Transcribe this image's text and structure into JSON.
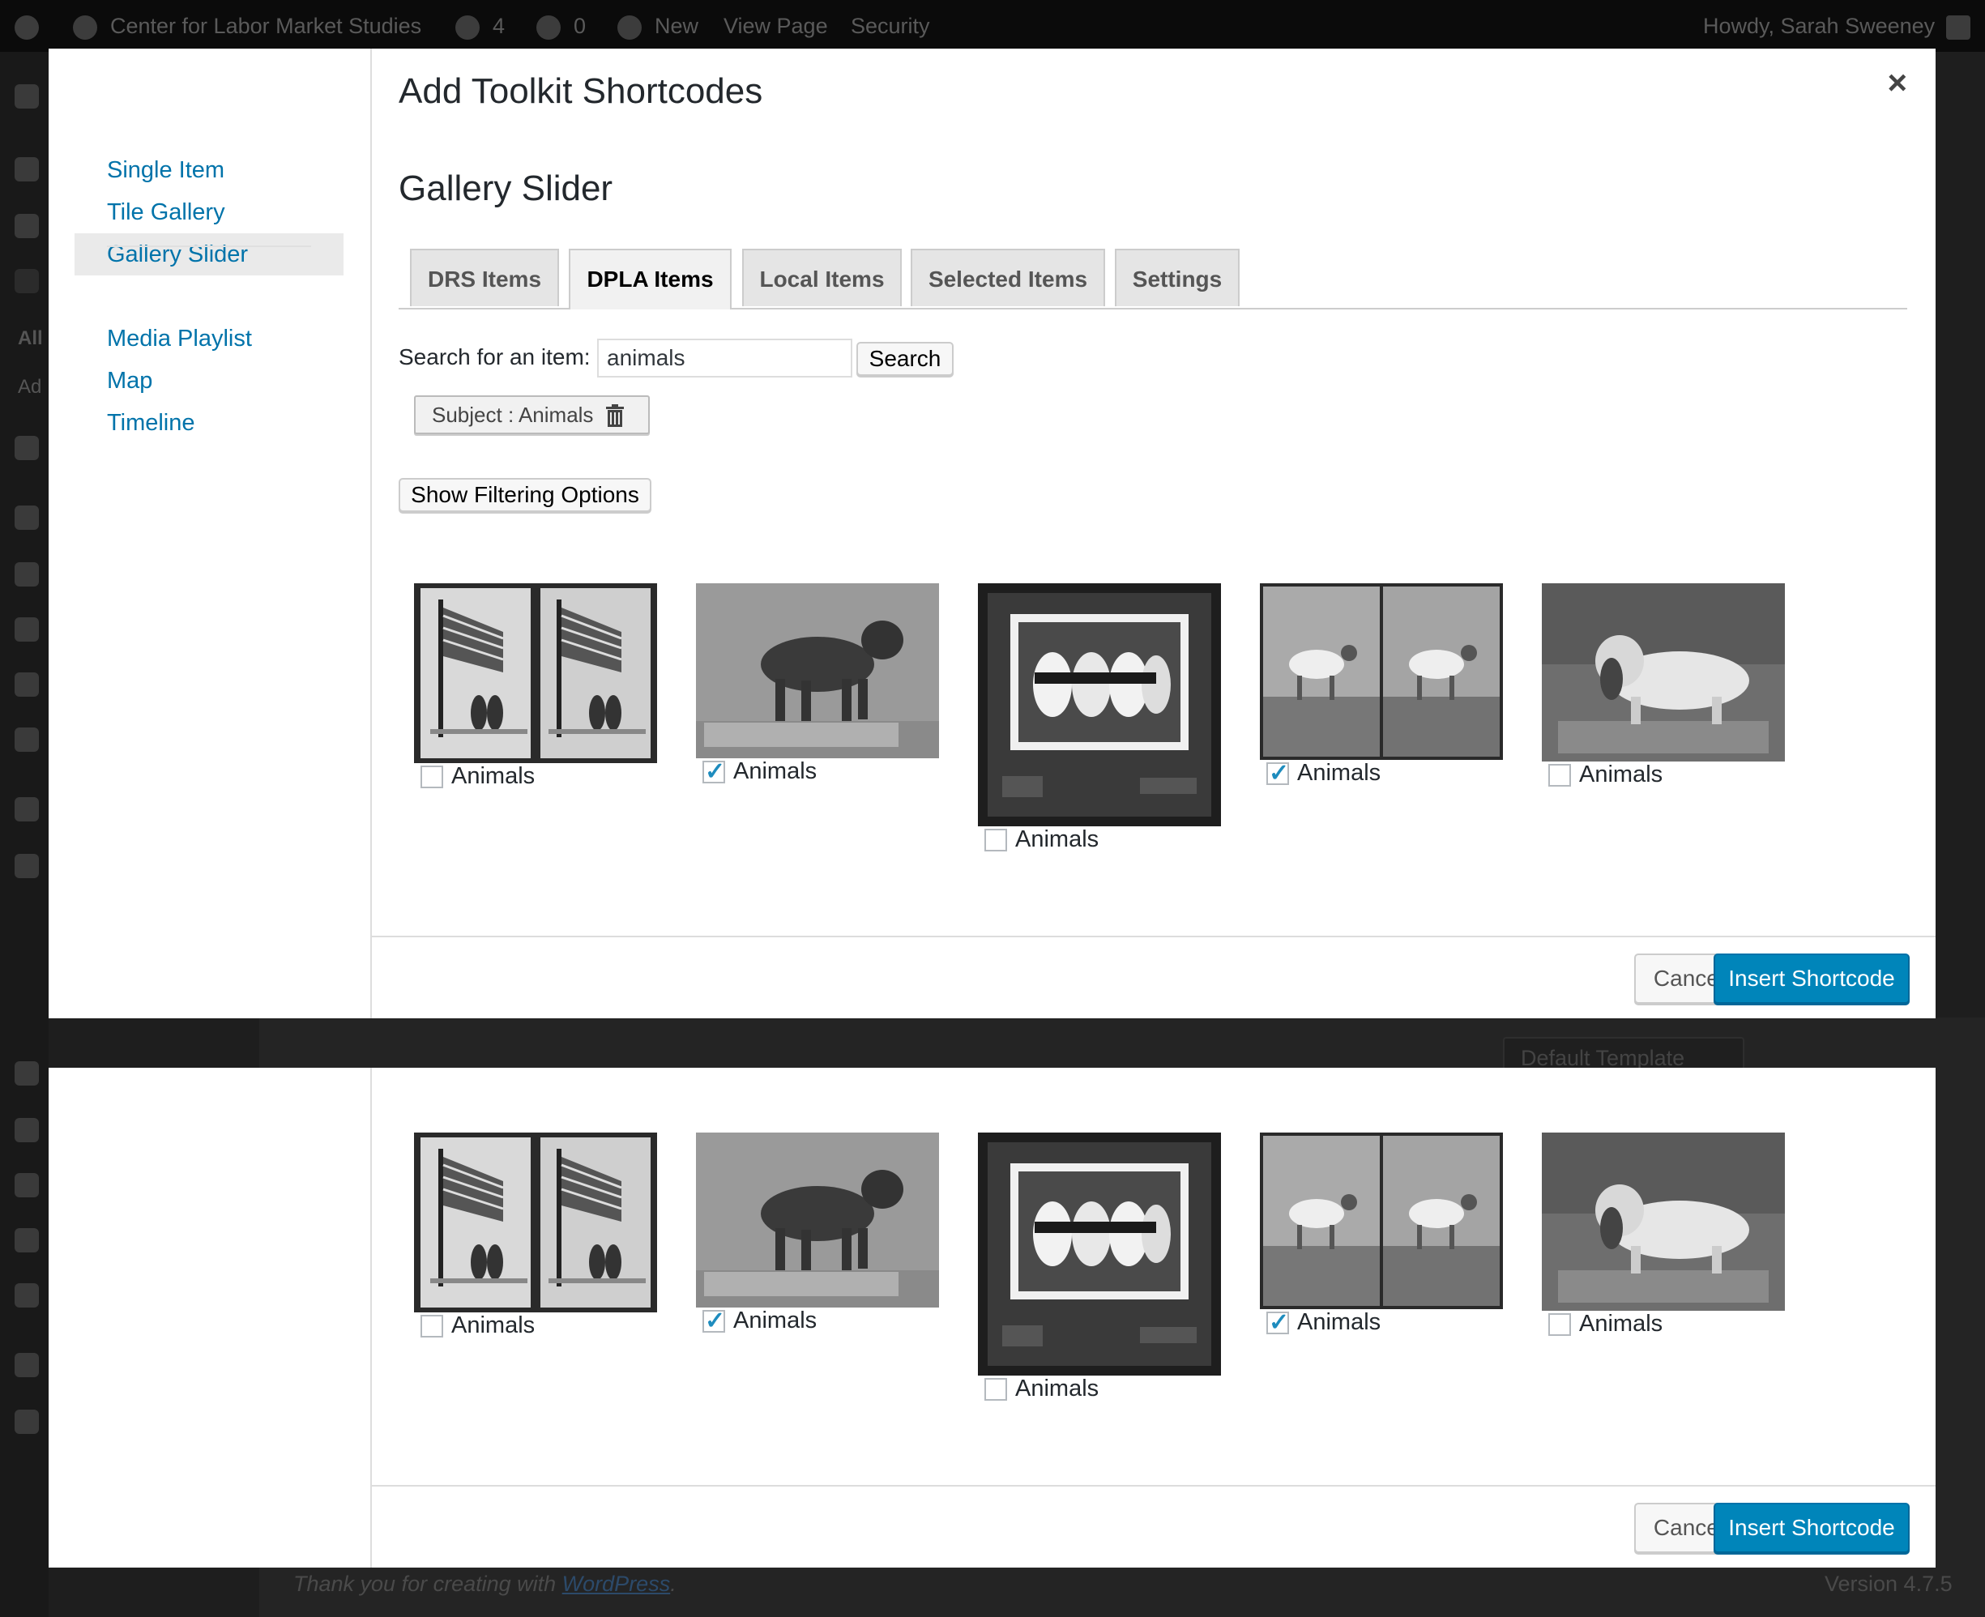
{
  "admin_bar": {
    "site_name": "Center for Labor Market Studies",
    "updates_count": "4",
    "comments_count": "0",
    "new_label": "New",
    "view_page_label": "View Page",
    "security_label": "Security",
    "howdy": "Howdy, Sarah Sweeney"
  },
  "background": {
    "template_select": "Default Template",
    "thanks_prefix": "Thank you for creating with ",
    "thanks_link": "WordPress",
    "thanks_suffix": ".",
    "version": "Version 4.7.5",
    "sidebar_text_all": "All",
    "sidebar_text_add": "Ad"
  },
  "modal": {
    "frame_title": "Add Toolkit Shortcodes",
    "close_label": "×",
    "menu": [
      "Single Item",
      "Tile Gallery",
      "Gallery Slider",
      "Media Playlist",
      "Map",
      "Timeline"
    ],
    "active_menu": "Gallery Slider",
    "section_title": "Gallery Slider",
    "tabs": [
      "DRS Items",
      "DPLA Items",
      "Local Items",
      "Selected Items",
      "Settings"
    ],
    "active_tab": "DPLA Items",
    "search": {
      "label": "Search for an item:",
      "value": "animals",
      "button": "Search"
    },
    "filter_tag": "Subject : Animals",
    "show_filtering_options": "Show Filtering Options",
    "items": [
      {
        "label": "Animals",
        "checked": false,
        "image": "stereo-flag-birds"
      },
      {
        "label": "Animals",
        "checked": true,
        "image": "dog-statue"
      },
      {
        "label": "Animals",
        "checked": false,
        "image": "framed-puppies"
      },
      {
        "label": "Animals",
        "checked": true,
        "image": "stereo-pointer-dog"
      },
      {
        "label": "Animals",
        "checked": false,
        "image": "spaniel-on-table"
      }
    ],
    "cancel": "Cancel",
    "insert": "Insert Shortcode"
  }
}
